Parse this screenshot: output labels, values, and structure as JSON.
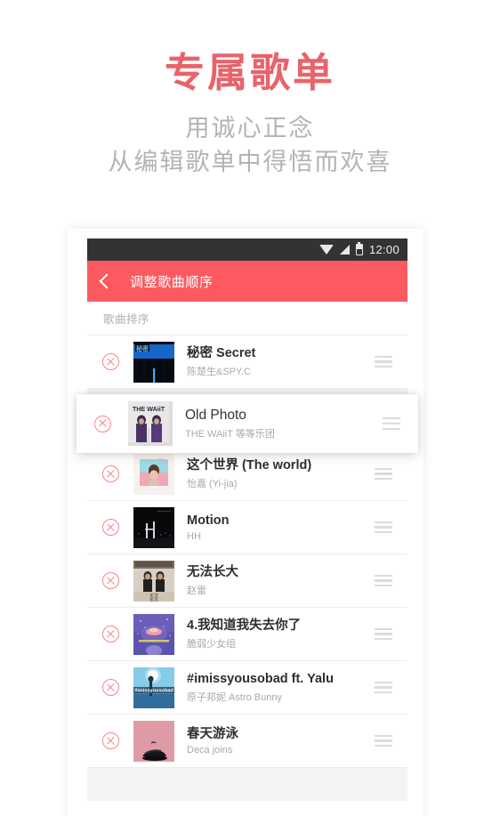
{
  "promo": {
    "title": "专属歌单",
    "subtitle_line1": "用诚心正念",
    "subtitle_line2": "从编辑歌单中得悟而欢喜",
    "title_color": "#e8636b",
    "subtitle_color": "#b3b3b3"
  },
  "statusbar": {
    "time": "12:00",
    "wifi_icon": "wifi-icon",
    "signal_icon": "signal-icon",
    "battery_icon": "battery-icon",
    "background": "#333335"
  },
  "appbar": {
    "back_icon": "back-chevron-icon",
    "title": "调整歌曲顺序",
    "background": "#fc5a60"
  },
  "section": {
    "label": "歌曲排序"
  },
  "icons": {
    "delete": "remove-circle-icon",
    "drag": "drag-handle-icon"
  },
  "dragging_item": {
    "title": "Old Photo",
    "artist": "THE WAiiT 等等乐团",
    "art_name": "album-art-old-photo"
  },
  "songs": [
    {
      "title": "秘密 Secret",
      "artist": "陈楚生&SPY.C",
      "art_name": "album-art-secret"
    },
    {
      "title": "这个世界 (The world)",
      "artist": "怡嘉 (Yi-jia)",
      "art_name": "album-art-the-world"
    },
    {
      "title": "Motion",
      "artist": "HH",
      "art_name": "album-art-motion"
    },
    {
      "title": "无法长大",
      "artist": "赵雷",
      "art_name": "album-art-wufazhangda"
    },
    {
      "title": "4.我知道我失去你了",
      "artist": "脆弱少女组",
      "art_name": "album-art-wozhidao"
    },
    {
      "title": "#imissyousobad ft. Yalu",
      "artist": "原子邦妮 Astro Bunny",
      "art_name": "album-art-imissyousobad"
    },
    {
      "title": "春天游泳",
      "artist": "Deca joins",
      "art_name": "album-art-chuntianyouyong"
    }
  ]
}
